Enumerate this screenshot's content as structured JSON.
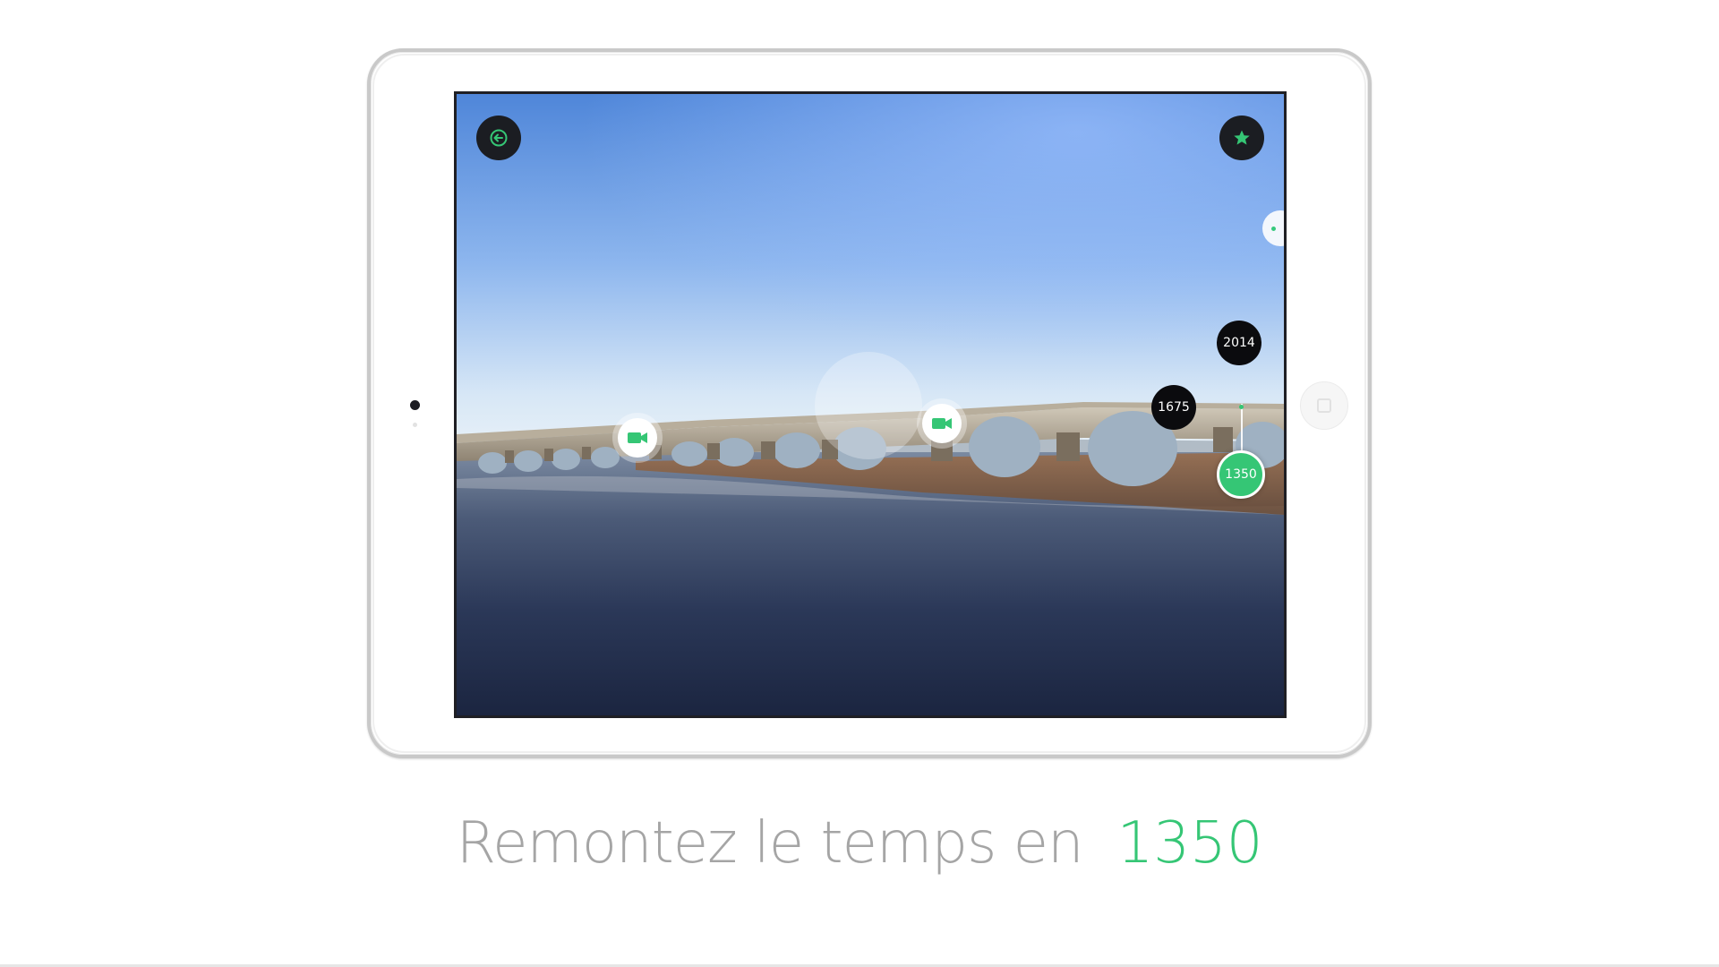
{
  "screen": {
    "back_button": {
      "icon": "back-arrow-icon"
    },
    "favorite_button": {
      "icon": "star-icon"
    },
    "hotspots": [
      {
        "icon": "video-camera-icon"
      },
      {
        "icon": "video-camera-icon"
      }
    ],
    "timeline": {
      "years": [
        "2014",
        "1675",
        "1350"
      ],
      "selected": "1350"
    }
  },
  "caption": {
    "text": "Remontez le temps en",
    "year": "1350"
  },
  "colors": {
    "accent": "#35c675",
    "caption_text": "#a5a5a5",
    "button_dark": "#1b1d22"
  }
}
